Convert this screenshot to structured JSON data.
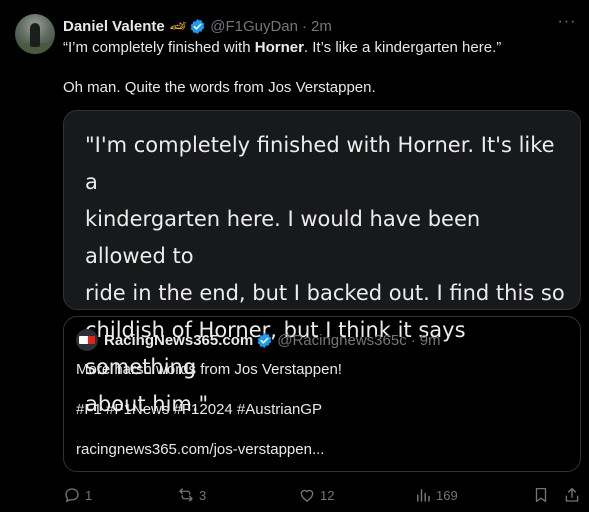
{
  "author": {
    "name": "Daniel Valente",
    "emoji": "🏎",
    "handle": "@F1GuyDan",
    "separator": "·",
    "time": "2m"
  },
  "tweet": {
    "line1_prefix": "“I’m completely finished with ",
    "line1_bold": "Horner",
    "line1_suffix": ". It’s like a kindergarten here.”",
    "line2": "Oh man. Quite the words from Jos Verstappen."
  },
  "image_quote": {
    "line1": "\"I'm completely finished with Horner. It's like a",
    "line2": "kindergarten here. I would have been allowed to",
    "line3": "ride in the end, but I backed out. I find this so",
    "line4": "childish of Horner, but I think it says something",
    "line5": "about him.\""
  },
  "quoted_tweet": {
    "name": "RacingNews365.com",
    "handle": "@Racingnews365c",
    "separator": "·",
    "time": "9m",
    "text": "More harsh words from Jos Verstappen!",
    "hashtags": "#F1 #F1News #F12024 #AustrianGP",
    "link": "racingnews365.com/jos-verstappen..."
  },
  "actions": {
    "replies": "1",
    "reposts": "3",
    "likes": "12",
    "views": "169"
  },
  "colors": {
    "background": "#000000",
    "text": "#e7e9ea",
    "muted": "#71767b",
    "verified": "#1d9bf0",
    "border": "#2f3336"
  }
}
